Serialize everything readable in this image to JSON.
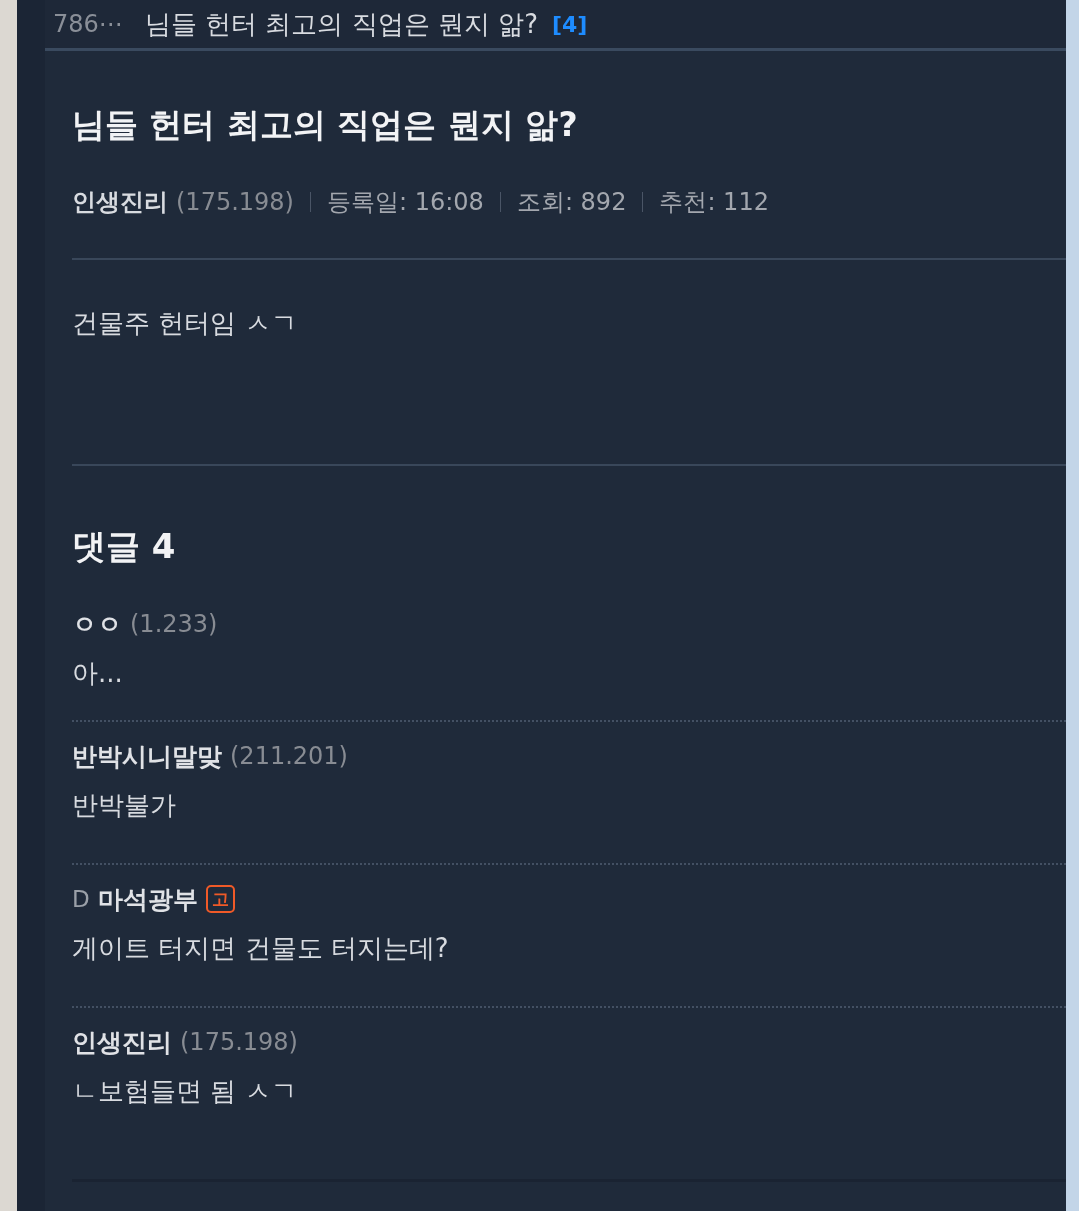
{
  "list_row": {
    "number": "786⋯",
    "title": "님들 헌터 최고의 직업은 뭔지 앎?",
    "comment_count": "[4]"
  },
  "post": {
    "title": "님들 헌터 최고의 직업은 뭔지 앎?",
    "author": "인생진리",
    "ip": "(175.198)",
    "meta": [
      "등록일: 16:08",
      "조회: 892",
      "추천: 112"
    ],
    "body": "건물주 헌터임 ㅅㄱ"
  },
  "comments_heading": "댓글 4",
  "comments": [
    {
      "author": "ㅇㅇ",
      "ip": "(1.233)",
      "text": "아..."
    },
    {
      "author": "반박시니말맞",
      "ip": "(211.201)",
      "text": "반박불가"
    },
    {
      "prefix": "D",
      "author": "마석광부",
      "badge": "고",
      "text": "게이트 터지면 건물도 터지는데?"
    },
    {
      "author": "인생진리",
      "ip": "(175.198)",
      "text": "ㄴ보험들면 됨 ㅅㄱ"
    }
  ]
}
